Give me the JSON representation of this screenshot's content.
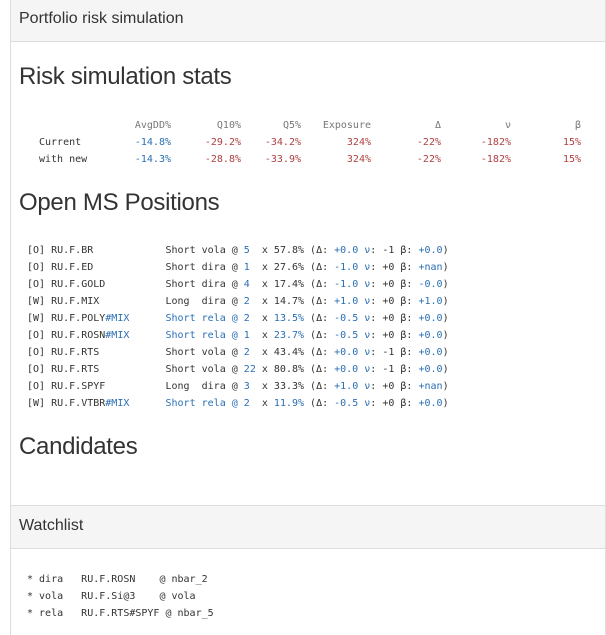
{
  "panel1": {
    "title": "Portfolio risk simulation",
    "stats_heading": "Risk simulation stats",
    "stats": {
      "headers": [
        "",
        "AvgDD%",
        "Q10%",
        "Q5%",
        "Exposure",
        "Δ",
        "ν",
        "β"
      ],
      "rows": [
        {
          "label": "Current",
          "values": [
            "-14.8%",
            "-29.2%",
            "-34.2%",
            "324%",
            "-22%",
            "-182%",
            "15%"
          ]
        },
        {
          "label": "with new",
          "values": [
            "-14.3%",
            "-28.8%",
            "-33.9%",
            "324%",
            "-22%",
            "-182%",
            "15%"
          ]
        }
      ]
    },
    "positions_heading": "Open MS Positions",
    "positions": [
      {
        "flag": "[O]",
        "ticker": "RU.F.BR",
        "suffix": "",
        "side": "Short",
        "kind": "vola",
        "qty": "5",
        "weight": "57.8%",
        "delta": "+0.0",
        "nu": "-1",
        "beta": "+0.0",
        "highlight": false
      },
      {
        "flag": "[O]",
        "ticker": "RU.F.ED",
        "suffix": "",
        "side": "Short",
        "kind": "dira",
        "qty": "1",
        "weight": "27.6%",
        "delta": "-1.0",
        "nu": "+0",
        "beta": "+nan",
        "highlight": false
      },
      {
        "flag": "[O]",
        "ticker": "RU.F.GOLD",
        "suffix": "",
        "side": "Short",
        "kind": "dira",
        "qty": "4",
        "weight": "17.4%",
        "delta": "-1.0",
        "nu": "+0",
        "beta": "-0.0",
        "highlight": false
      },
      {
        "flag": "[W]",
        "ticker": "RU.F.MIX",
        "suffix": "",
        "side": "Long ",
        "kind": "dira",
        "qty": "2",
        "weight": "14.7%",
        "delta": "+1.0",
        "nu": "+0",
        "beta": "+1.0",
        "highlight": false
      },
      {
        "flag": "[W]",
        "ticker": "RU.F.POLY",
        "suffix": "#MIX",
        "side": "Short",
        "kind": "rela",
        "qty": "2",
        "weight": "13.5%",
        "delta": "-0.5",
        "nu": "+0",
        "beta": "+0.0",
        "highlight": true
      },
      {
        "flag": "[O]",
        "ticker": "RU.F.ROSN",
        "suffix": "#MIX",
        "side": "Short",
        "kind": "rela",
        "qty": "1",
        "weight": "23.7%",
        "delta": "-0.5",
        "nu": "+0",
        "beta": "+0.0",
        "highlight": true
      },
      {
        "flag": "[O]",
        "ticker": "RU.F.RTS",
        "suffix": "",
        "side": "Short",
        "kind": "vola",
        "qty": "2",
        "weight": "43.4%",
        "delta": "+0.0",
        "nu": "-1",
        "beta": "+0.0",
        "highlight": false
      },
      {
        "flag": "[O]",
        "ticker": "RU.F.RTS",
        "suffix": "",
        "side": "Short",
        "kind": "vola",
        "qty": "22",
        "weight": "80.8%",
        "delta": "+0.0",
        "nu": "-1",
        "beta": "+0.0",
        "highlight": false
      },
      {
        "flag": "[O]",
        "ticker": "RU.F.SPYF",
        "suffix": "",
        "side": "Long ",
        "kind": "dira",
        "qty": "3",
        "weight": "33.3%",
        "delta": "+1.0",
        "nu": "+0",
        "beta": "+nan",
        "highlight": false
      },
      {
        "flag": "[W]",
        "ticker": "RU.F.VTBR",
        "suffix": "#MIX",
        "side": "Short",
        "kind": "rela",
        "qty": "2",
        "weight": "11.9%",
        "delta": "-0.5",
        "nu": "+0",
        "beta": "+0.0",
        "highlight": true
      }
    ],
    "candidates_heading": "Candidates"
  },
  "panel2": {
    "title": "Watchlist",
    "items": [
      {
        "text": "* dira   RU.F.ROSN    @ nbar_2"
      },
      {
        "text": "* vola   RU.F.Si@3    @ vola"
      },
      {
        "text": "* rela   RU.F.RTS#SPYF @ nbar_5"
      }
    ]
  }
}
